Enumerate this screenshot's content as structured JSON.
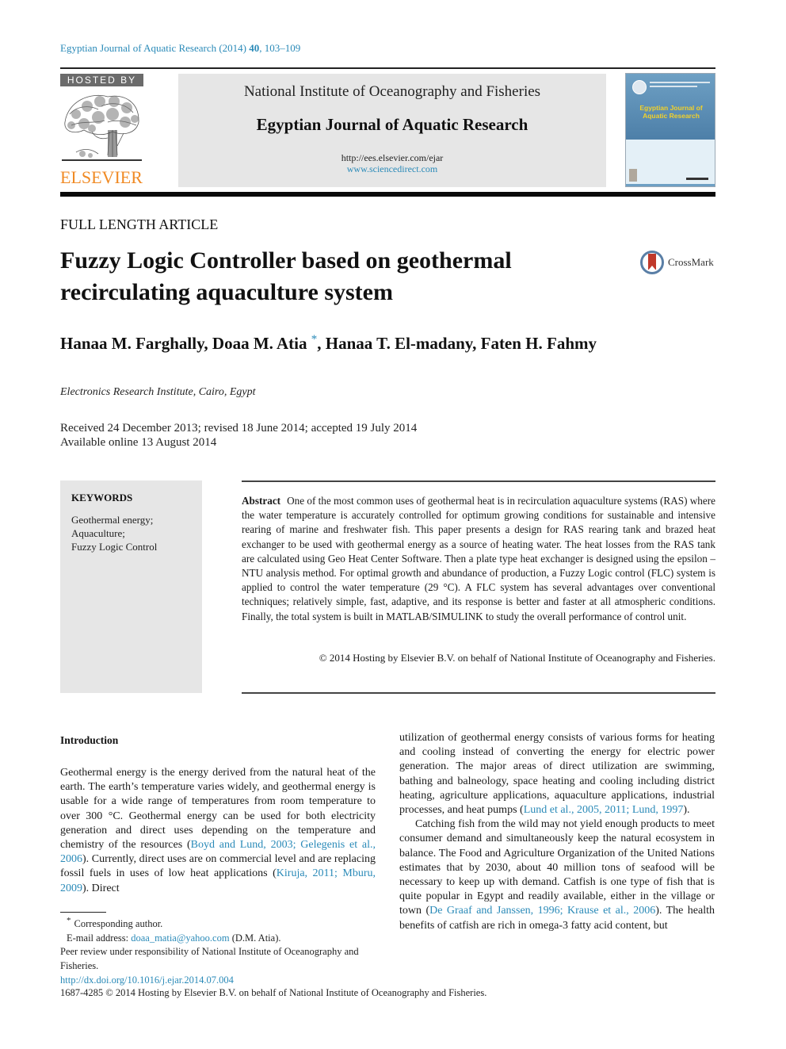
{
  "citation": {
    "journal": "Egyptian Journal of Aquatic Research (2014)",
    "volume": "40",
    "pages": ", 103–109"
  },
  "header": {
    "hosted_by": "HOSTED BY",
    "publisher_logo_word": "ELSEVIER",
    "institute": "National Institute of Oceanography and Fisheries",
    "journal": "Egyptian Journal of Aquatic Research",
    "url_journal": "http://ees.elsevier.com/ejar",
    "url_sciencedirect": "www.sciencedirect.com",
    "cover_title": "Egyptian Journal of Aquatic Research"
  },
  "article": {
    "type": "FULL LENGTH ARTICLE",
    "title": "Fuzzy Logic Controller based on geothermal recirculating aquaculture system",
    "crossmark_label": "CrossMark",
    "authors_part1": "Hanaa M. Farghally, Doaa M. Atia ",
    "corresponding_mark": "*",
    "authors_part2": ", Hanaa T. El-madany, Faten H. Fahmy",
    "affiliation": "Electronics Research Institute, Cairo, Egypt",
    "dates_line1": "Received 24 December 2013; revised 18 June 2014; accepted 19 July 2014",
    "dates_line2": "Available online 13 August 2014"
  },
  "keywords": {
    "heading": "KEYWORDS",
    "items": [
      "Geothermal energy;",
      "Aquaculture;",
      "Fuzzy Logic Control"
    ]
  },
  "abstract": {
    "heading": "Abstract",
    "text": "One of the most common uses of geothermal heat is in recirculation aquaculture systems (RAS) where the water temperature is accurately controlled for optimum growing conditions for sustainable and intensive rearing of marine and freshwater fish. This paper presents a design for RAS rearing tank and brazed heat exchanger to be used with geothermal energy as a source of heating water. The heat losses from the RAS tank are calculated using Geo Heat Center Software. Then a plate type heat exchanger is designed using the epsilon – NTU analysis method. For optimal growth and abundance of production, a Fuzzy Logic control (FLC) system is applied to control the water temperature (29 °C). A FLC system has several advantages over conventional techniques; relatively simple, fast, adaptive, and its response is better and faster at all atmospheric conditions. Finally, the total system is built in MATLAB/SIMULINK to study the overall performance of control unit.",
    "copyright": "© 2014 Hosting by Elsevier B.V. on behalf of National Institute of Oceanography and Fisheries."
  },
  "body": {
    "intro_heading": "Introduction",
    "left_p1_a": "Geothermal energy is the energy derived from the natural heat of the earth. The earth’s temperature varies widely, and geothermal energy is usable for a wide range of temperatures from room temperature to over 300 °C. Geothermal energy can be used for both electricity generation and direct uses depending on the temperature and chemistry of the resources (",
    "left_ref1": "Boyd and Lund, 2003; Gelegenis et al., 2006",
    "left_p1_b": "). Currently, direct uses are on commercial level and are replacing fossil fuels in uses of low heat applications (",
    "left_ref2": "Kiruja, 2011; Mburu, 2009",
    "left_p1_c": "). Direct",
    "right_p1_a": "utilization of geothermal energy consists of various forms for heating and cooling instead of converting the energy for electric power generation. The major areas of direct utilization are swimming, bathing and balneology, space heating and cooling including district heating, agriculture applications, aquaculture applications, industrial processes, and heat pumps (",
    "right_ref1": "Lund et al., 2005, 2011; Lund, 1997",
    "right_p1_b": ").",
    "right_p2_a": "Catching fish from the wild may not yield enough products to meet consumer demand and simultaneously keep the natural ecosystem in balance. The Food and Agriculture Organization of the United Nations estimates that by 2030, about 40 million tons of seafood will be necessary to keep up with demand. Catfish is one type of fish that is quite popular in Egypt and readily available, either in the village or town (",
    "right_ref2": "De Graaf and Janssen, 1996; Krause et al., 2006",
    "right_p2_b": "). The health benefits of catfish are rich in omega-3 fatty acid content, but"
  },
  "footnotes": {
    "star": "*",
    "corresponding": "Corresponding author.",
    "email_label": "E-mail address: ",
    "email": "doaa_matia@yahoo.com",
    "email_suffix": " (D.M. Atia).",
    "peer_review": "Peer review under responsibility of National Institute of Oceanography and Fisheries.",
    "doi": "http://dx.doi.org/10.1016/j.ejar.2014.07.004",
    "issn_line": "1687-4285 © 2014 Hosting by Elsevier B.V. on behalf of National Institute of Oceanography and Fisheries."
  },
  "colors": {
    "link": "#2a8ab8",
    "elsevier_orange": "#f08a24",
    "header_gray": "#e6e6e6",
    "crossmark_red": "#c0392b"
  }
}
